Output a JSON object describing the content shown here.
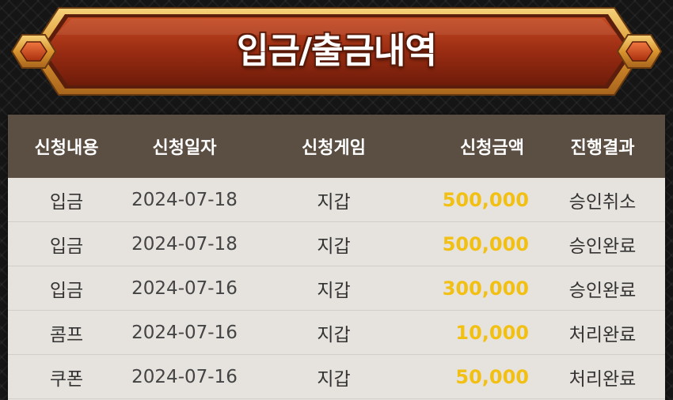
{
  "header": {
    "title": "입금/출금내역"
  },
  "colors": {
    "banner_red": "#9c3014",
    "banner_gold": "#e2a03c",
    "table_header_bg": "#5b4e42",
    "row_bg": "#e6e3de",
    "amount": "#f2c012"
  },
  "table": {
    "columns": [
      "신청내용",
      "신청일자",
      "신청게임",
      "신청금액",
      "진행결과"
    ],
    "rows": [
      {
        "type": "입금",
        "date": "2024-07-18",
        "game": "지갑",
        "amount": "500,000",
        "result": "승인취소"
      },
      {
        "type": "입금",
        "date": "2024-07-18",
        "game": "지갑",
        "amount": "500,000",
        "result": "승인완료"
      },
      {
        "type": "입금",
        "date": "2024-07-16",
        "game": "지갑",
        "amount": "300,000",
        "result": "승인완료"
      },
      {
        "type": "콤프",
        "date": "2024-07-16",
        "game": "지갑",
        "amount": "10,000",
        "result": "처리완료"
      },
      {
        "type": "쿠폰",
        "date": "2024-07-16",
        "game": "지갑",
        "amount": "50,000",
        "result": "처리완료"
      }
    ]
  }
}
